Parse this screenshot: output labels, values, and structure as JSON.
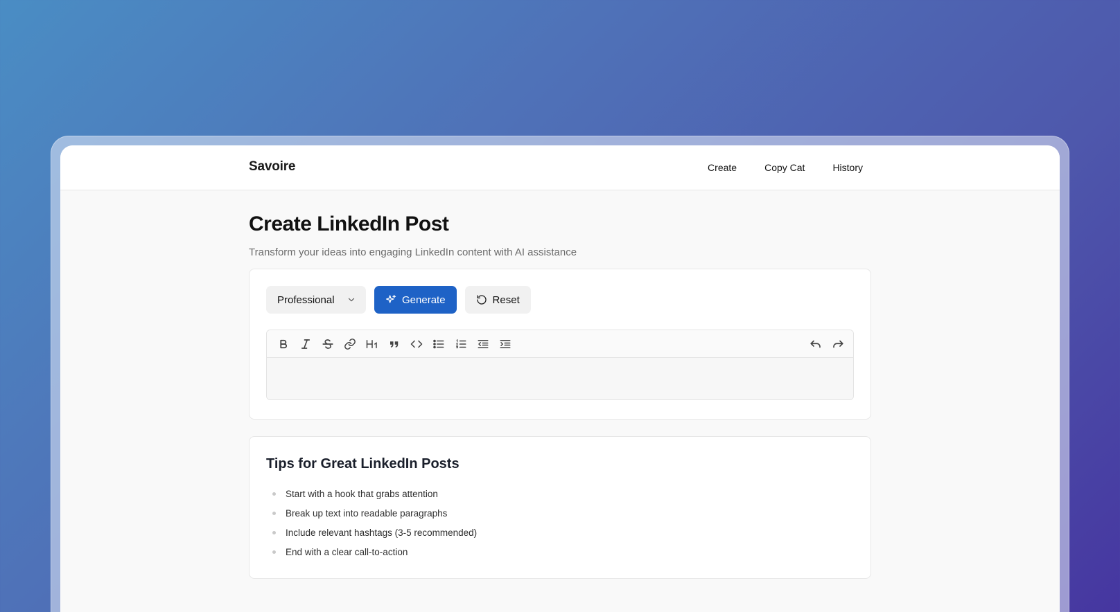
{
  "colors": {
    "accent": "#1e62c6",
    "page_bg": "#f9f9f9"
  },
  "header": {
    "brand": "Savoire",
    "nav": [
      {
        "label": "Create"
      },
      {
        "label": "Copy Cat"
      },
      {
        "label": "History"
      }
    ]
  },
  "page": {
    "title": "Create LinkedIn Post",
    "subtitle": "Transform your ideas into engaging LinkedIn content with AI assistance"
  },
  "composer": {
    "tone_select": {
      "value": "Professional",
      "icon": "chevron-down-icon"
    },
    "generate_label": "Generate",
    "reset_label": "Reset",
    "toolbar_icons": [
      "bold-icon",
      "italic-icon",
      "strikethrough-icon",
      "link-icon",
      "heading-icon",
      "quote-icon",
      "code-icon",
      "bullet-list-icon",
      "ordered-list-icon",
      "outdent-icon",
      "indent-icon",
      "undo-icon",
      "redo-icon"
    ],
    "editor_content": ""
  },
  "tips": {
    "title": "Tips for Great LinkedIn Posts",
    "items": [
      "Start with a hook that grabs attention",
      "Break up text into readable paragraphs",
      "Include relevant hashtags (3-5 recommended)",
      "End with a clear call-to-action"
    ]
  }
}
